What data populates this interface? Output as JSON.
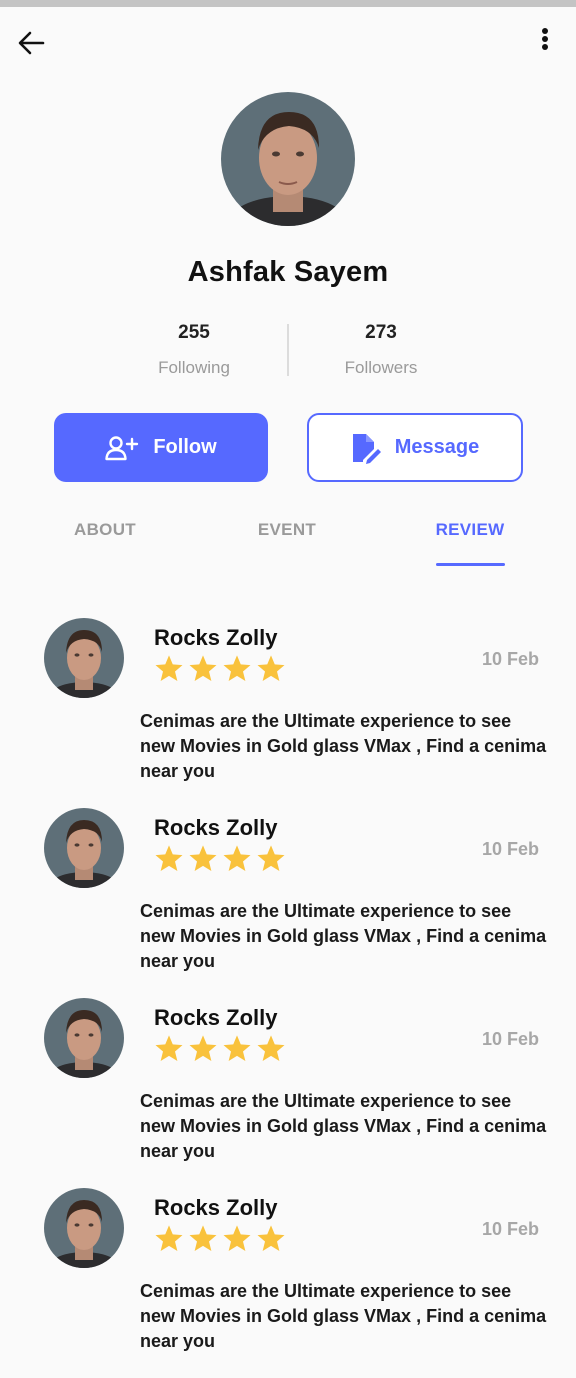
{
  "profile": {
    "name": "Ashfak Sayem",
    "following_count": "255",
    "following_label": "Following",
    "followers_count": "273",
    "followers_label": "Followers"
  },
  "actions": {
    "follow_label": "Follow",
    "message_label": "Message"
  },
  "tabs": [
    {
      "label": "ABOUT",
      "active": false
    },
    {
      "label": "EVENT",
      "active": false
    },
    {
      "label": "REVIEW",
      "active": true
    }
  ],
  "reviews": [
    {
      "name": "Rocks Zolly",
      "rating": 4,
      "date": "10 Feb",
      "text": "Cenimas are the Ultimate experience to see new Movies in Gold glass VMax , Find a cenima near you"
    },
    {
      "name": "Rocks Zolly",
      "rating": 4,
      "date": "10 Feb",
      "text": "Cenimas are the Ultimate experience to see new Movies in Gold glass VMax , Find a cenima near you"
    },
    {
      "name": "Rocks Zolly",
      "rating": 4,
      "date": "10 Feb",
      "text": "Cenimas are the Ultimate experience to see new Movies in Gold glass VMax , Find a cenima near you"
    },
    {
      "name": "Rocks Zolly",
      "rating": 4,
      "date": "10 Feb",
      "text": "Cenimas are the Ultimate experience to see new Movies in Gold glass VMax , Find a cenima near you"
    }
  ],
  "icons": {
    "back": "arrow-left-icon",
    "more": "more-vertical-icon",
    "follow": "user-plus-icon",
    "message": "edit-document-icon",
    "star": "star-icon"
  },
  "colors": {
    "accent": "#5669ff",
    "star": "#f9c23c",
    "muted_text": "#9a9a9a",
    "background": "#fafafa"
  }
}
